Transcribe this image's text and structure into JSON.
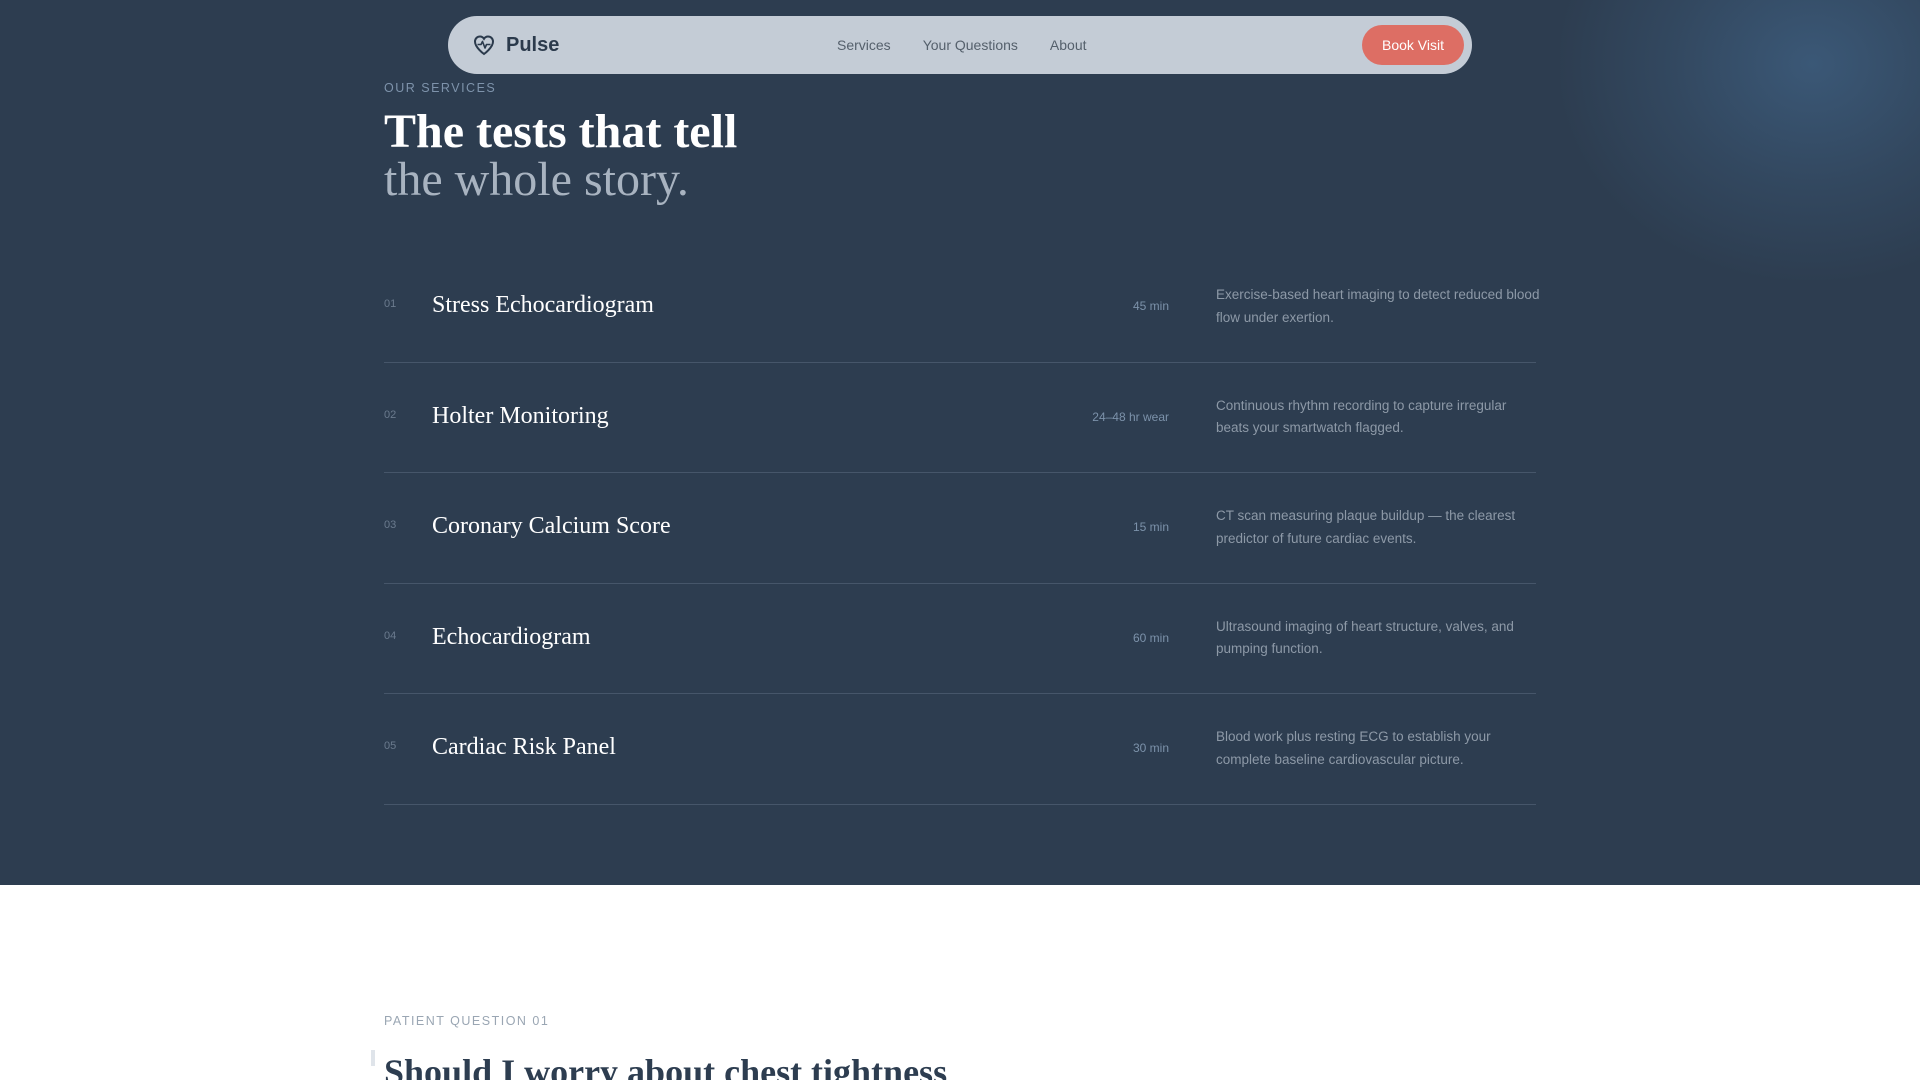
{
  "nav": {
    "brand": "Pulse",
    "brand_icon": "heart-icon",
    "links": [
      "Services",
      "Your Questions",
      "About"
    ],
    "cta": "Book Visit",
    "cta_color": "#dd6e64"
  },
  "services": {
    "eyebrow": "OUR SERVICES",
    "headline_line1": "The tests that tell",
    "headline_line2": "the whole story.",
    "items": [
      {
        "num": "01",
        "name": "Stress Echocardiogram",
        "duration": "45 min",
        "description": "Exercise-based heart imaging to detect reduced blood flow under exertion."
      },
      {
        "num": "02",
        "name": "Holter Monitoring",
        "duration": "24–48 hr wear",
        "description": "Continuous rhythm recording to capture irregular beats your smartwatch flagged."
      },
      {
        "num": "03",
        "name": "Coronary Calcium Score",
        "duration": "15 min",
        "description": "CT scan measuring plaque buildup — the clearest predictor of future cardiac events."
      },
      {
        "num": "04",
        "name": "Echocardiogram",
        "duration": "60 min",
        "description": "Ultrasound imaging of heart structure, valves, and pumping function."
      },
      {
        "num": "05",
        "name": "Cardiac Risk Panel",
        "duration": "30 min",
        "description": "Blood work plus resting ECG to establish your complete baseline cardiovascular picture."
      }
    ]
  },
  "question": {
    "eyebrow": "PATIENT QUESTION 01",
    "title": "Should I worry about chest tightness"
  },
  "colors": {
    "dark_bg": "#2d3d50",
    "nav_bg": "#c4ccd6",
    "accent": "#dd6e64"
  }
}
